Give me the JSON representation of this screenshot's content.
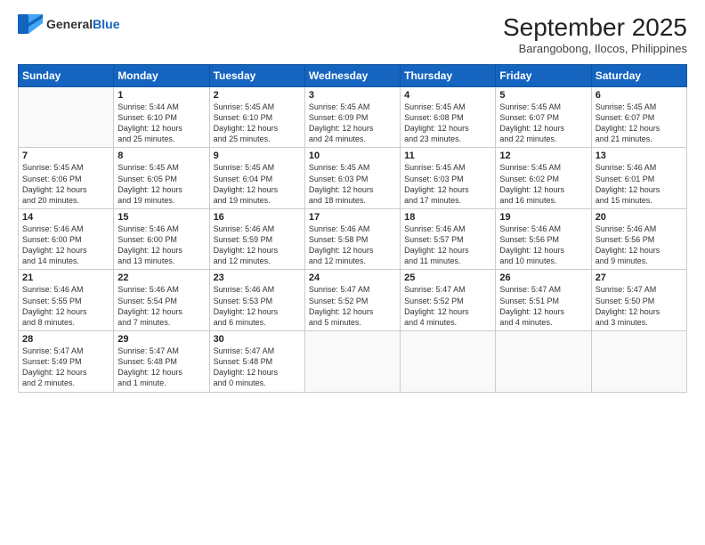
{
  "logo": {
    "general": "General",
    "blue": "Blue"
  },
  "title": "September 2025",
  "subtitle": "Barangobong, Ilocos, Philippines",
  "weekdays": [
    "Sunday",
    "Monday",
    "Tuesday",
    "Wednesday",
    "Thursday",
    "Friday",
    "Saturday"
  ],
  "weeks": [
    [
      {
        "day": "",
        "content": ""
      },
      {
        "day": "1",
        "content": "Sunrise: 5:44 AM\nSunset: 6:10 PM\nDaylight: 12 hours\nand 25 minutes."
      },
      {
        "day": "2",
        "content": "Sunrise: 5:45 AM\nSunset: 6:10 PM\nDaylight: 12 hours\nand 25 minutes."
      },
      {
        "day": "3",
        "content": "Sunrise: 5:45 AM\nSunset: 6:09 PM\nDaylight: 12 hours\nand 24 minutes."
      },
      {
        "day": "4",
        "content": "Sunrise: 5:45 AM\nSunset: 6:08 PM\nDaylight: 12 hours\nand 23 minutes."
      },
      {
        "day": "5",
        "content": "Sunrise: 5:45 AM\nSunset: 6:07 PM\nDaylight: 12 hours\nand 22 minutes."
      },
      {
        "day": "6",
        "content": "Sunrise: 5:45 AM\nSunset: 6:07 PM\nDaylight: 12 hours\nand 21 minutes."
      }
    ],
    [
      {
        "day": "7",
        "content": "Sunrise: 5:45 AM\nSunset: 6:06 PM\nDaylight: 12 hours\nand 20 minutes."
      },
      {
        "day": "8",
        "content": "Sunrise: 5:45 AM\nSunset: 6:05 PM\nDaylight: 12 hours\nand 19 minutes."
      },
      {
        "day": "9",
        "content": "Sunrise: 5:45 AM\nSunset: 6:04 PM\nDaylight: 12 hours\nand 19 minutes."
      },
      {
        "day": "10",
        "content": "Sunrise: 5:45 AM\nSunset: 6:03 PM\nDaylight: 12 hours\nand 18 minutes."
      },
      {
        "day": "11",
        "content": "Sunrise: 5:45 AM\nSunset: 6:03 PM\nDaylight: 12 hours\nand 17 minutes."
      },
      {
        "day": "12",
        "content": "Sunrise: 5:45 AM\nSunset: 6:02 PM\nDaylight: 12 hours\nand 16 minutes."
      },
      {
        "day": "13",
        "content": "Sunrise: 5:46 AM\nSunset: 6:01 PM\nDaylight: 12 hours\nand 15 minutes."
      }
    ],
    [
      {
        "day": "14",
        "content": "Sunrise: 5:46 AM\nSunset: 6:00 PM\nDaylight: 12 hours\nand 14 minutes."
      },
      {
        "day": "15",
        "content": "Sunrise: 5:46 AM\nSunset: 6:00 PM\nDaylight: 12 hours\nand 13 minutes."
      },
      {
        "day": "16",
        "content": "Sunrise: 5:46 AM\nSunset: 5:59 PM\nDaylight: 12 hours\nand 12 minutes."
      },
      {
        "day": "17",
        "content": "Sunrise: 5:46 AM\nSunset: 5:58 PM\nDaylight: 12 hours\nand 12 minutes."
      },
      {
        "day": "18",
        "content": "Sunrise: 5:46 AM\nSunset: 5:57 PM\nDaylight: 12 hours\nand 11 minutes."
      },
      {
        "day": "19",
        "content": "Sunrise: 5:46 AM\nSunset: 5:56 PM\nDaylight: 12 hours\nand 10 minutes."
      },
      {
        "day": "20",
        "content": "Sunrise: 5:46 AM\nSunset: 5:56 PM\nDaylight: 12 hours\nand 9 minutes."
      }
    ],
    [
      {
        "day": "21",
        "content": "Sunrise: 5:46 AM\nSunset: 5:55 PM\nDaylight: 12 hours\nand 8 minutes."
      },
      {
        "day": "22",
        "content": "Sunrise: 5:46 AM\nSunset: 5:54 PM\nDaylight: 12 hours\nand 7 minutes."
      },
      {
        "day": "23",
        "content": "Sunrise: 5:46 AM\nSunset: 5:53 PM\nDaylight: 12 hours\nand 6 minutes."
      },
      {
        "day": "24",
        "content": "Sunrise: 5:47 AM\nSunset: 5:52 PM\nDaylight: 12 hours\nand 5 minutes."
      },
      {
        "day": "25",
        "content": "Sunrise: 5:47 AM\nSunset: 5:52 PM\nDaylight: 12 hours\nand 4 minutes."
      },
      {
        "day": "26",
        "content": "Sunrise: 5:47 AM\nSunset: 5:51 PM\nDaylight: 12 hours\nand 4 minutes."
      },
      {
        "day": "27",
        "content": "Sunrise: 5:47 AM\nSunset: 5:50 PM\nDaylight: 12 hours\nand 3 minutes."
      }
    ],
    [
      {
        "day": "28",
        "content": "Sunrise: 5:47 AM\nSunset: 5:49 PM\nDaylight: 12 hours\nand 2 minutes."
      },
      {
        "day": "29",
        "content": "Sunrise: 5:47 AM\nSunset: 5:48 PM\nDaylight: 12 hours\nand 1 minute."
      },
      {
        "day": "30",
        "content": "Sunrise: 5:47 AM\nSunset: 5:48 PM\nDaylight: 12 hours\nand 0 minutes."
      },
      {
        "day": "",
        "content": ""
      },
      {
        "day": "",
        "content": ""
      },
      {
        "day": "",
        "content": ""
      },
      {
        "day": "",
        "content": ""
      }
    ]
  ]
}
